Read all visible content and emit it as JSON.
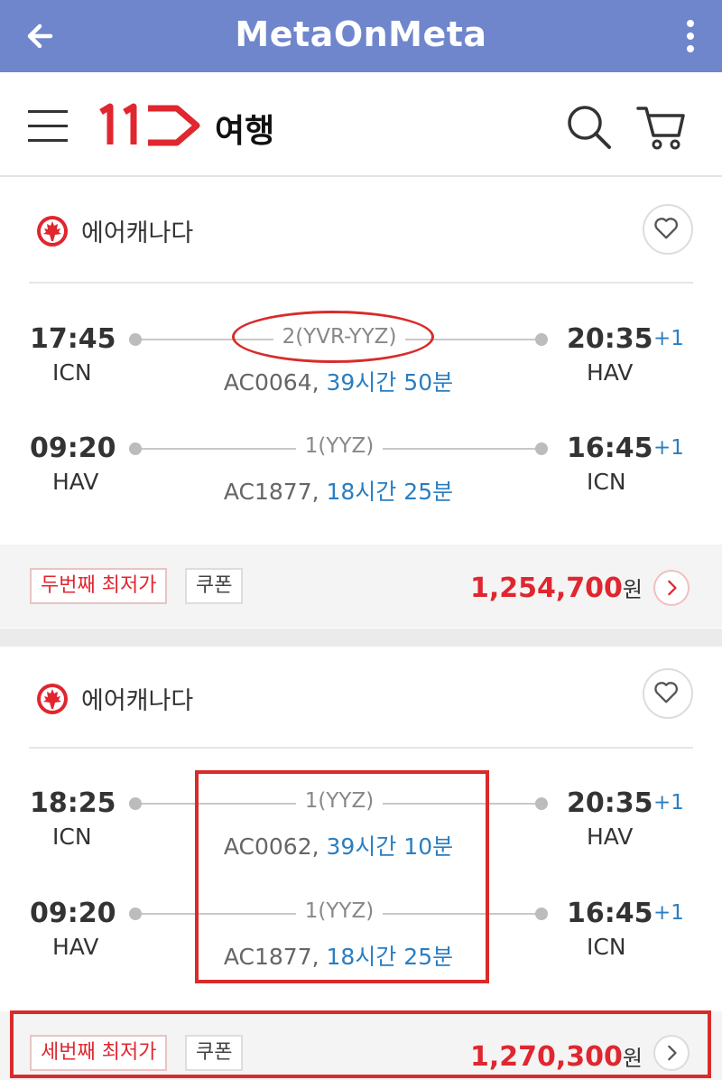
{
  "appbar": {
    "title": "MetaOnMeta"
  },
  "header": {
    "brand": "여행"
  },
  "results": [
    {
      "airline": "에어캐나다",
      "legs": [
        {
          "dep_time": "17:45",
          "dep_code": "ICN",
          "arr_time": "20:35",
          "arr_plus": "+1",
          "arr_code": "HAV",
          "stops": "2(YVR-YYZ)",
          "flight_no": "AC0064,",
          "duration": "39시간 50분"
        },
        {
          "dep_time": "09:20",
          "dep_code": "HAV",
          "arr_time": "16:45",
          "arr_plus": "+1",
          "arr_code": "ICN",
          "stops": "1(YYZ)",
          "flight_no": "AC1877,",
          "duration": "18시간 25분"
        }
      ],
      "badge_rank": "두번째 최저가",
      "badge_coupon": "쿠폰",
      "price": "1,254,700",
      "currency": "원"
    },
    {
      "airline": "에어캐나다",
      "legs": [
        {
          "dep_time": "18:25",
          "dep_code": "ICN",
          "arr_time": "20:35",
          "arr_plus": "+1",
          "arr_code": "HAV",
          "stops": "1(YYZ)",
          "flight_no": "AC0062,",
          "duration": "39시간 10분"
        },
        {
          "dep_time": "09:20",
          "dep_code": "HAV",
          "arr_time": "16:45",
          "arr_plus": "+1",
          "arr_code": "ICN",
          "stops": "1(YYZ)",
          "flight_no": "AC1877,",
          "duration": "18시간 25분"
        }
      ],
      "badge_rank": "세번째 최저가",
      "badge_coupon": "쿠폰",
      "price": "1,270,300",
      "currency": "원"
    }
  ],
  "colors": {
    "appbar": "#6f86cc",
    "accent_red": "#e0262f",
    "duration_blue": "#2a7ec1",
    "annotation_red": "#d92b2b"
  }
}
